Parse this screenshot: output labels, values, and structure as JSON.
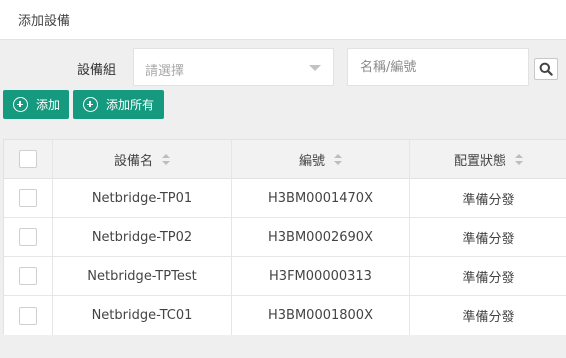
{
  "header": {
    "title": "添加設備"
  },
  "filter": {
    "group_label": "設備組",
    "group_placeholder": "請選擇",
    "search_placeholder": "名稱/編號"
  },
  "actions": {
    "add_label": "添加",
    "add_all_label": "添加所有"
  },
  "table": {
    "columns": [
      "設備名",
      "編號",
      "配置狀態"
    ],
    "rows": [
      {
        "name": "Netbridge-TP01",
        "code": "H3BM0001470X",
        "status": "準備分發"
      },
      {
        "name": "Netbridge-TP02",
        "code": "H3BM0002690X",
        "status": "準備分發"
      },
      {
        "name": "Netbridge-TPTest",
        "code": "H3FM00000313",
        "status": "準備分發"
      },
      {
        "name": "Netbridge-TC01",
        "code": "H3BM0001800X",
        "status": "準備分發"
      }
    ]
  },
  "colors": {
    "accent": "#159a80",
    "background": "#efefef",
    "header_bg": "#f2f2f2"
  },
  "icons": {
    "search": "magnifier-icon",
    "add": "plus-circle-icon",
    "sort": "sort-arrows-icon",
    "dropdown": "caret-down-icon"
  }
}
